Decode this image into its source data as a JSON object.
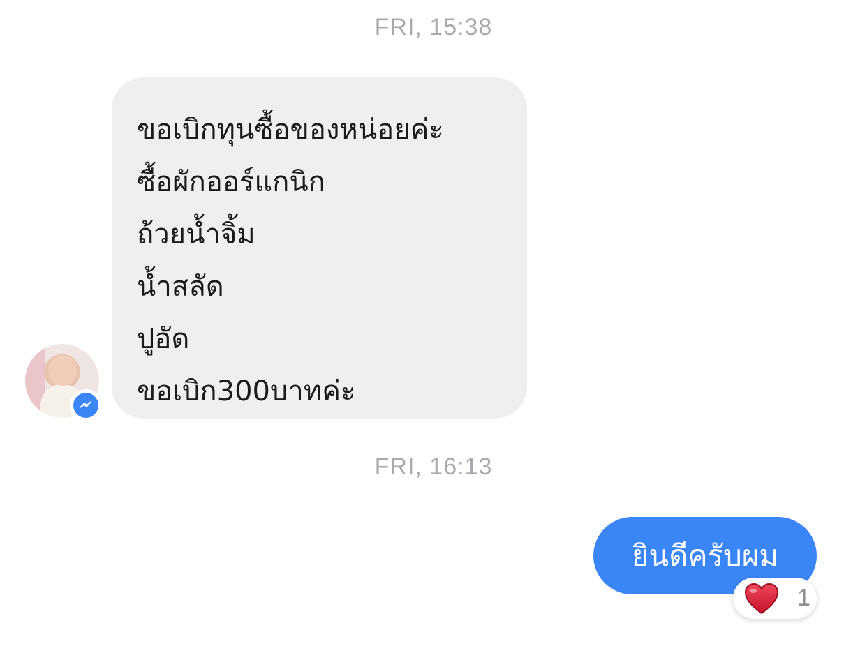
{
  "conversation": {
    "timestamps": [
      "FRI, 15:38",
      "FRI, 16:13"
    ],
    "incoming_message": {
      "lines": [
        "ขอเบิกทุนซื้อของหน่อยค่ะ",
        "ซื้อผักออร์แกนิก",
        "ถ้วยน้ำจิ้ม",
        "น้ำสลัด",
        "ปูอัด",
        "ขอเบิก300บาทค่ะ"
      ],
      "bubble_color": "#efefef"
    },
    "outgoing_message": {
      "text": "ยินดีครับผม",
      "bubble_color": "#3b86f7",
      "reaction": {
        "icon": "heart-icon",
        "count": "1"
      }
    },
    "sender_avatar": {
      "badge_icon": "messenger-icon",
      "badge_color": "#3b86f7"
    }
  }
}
